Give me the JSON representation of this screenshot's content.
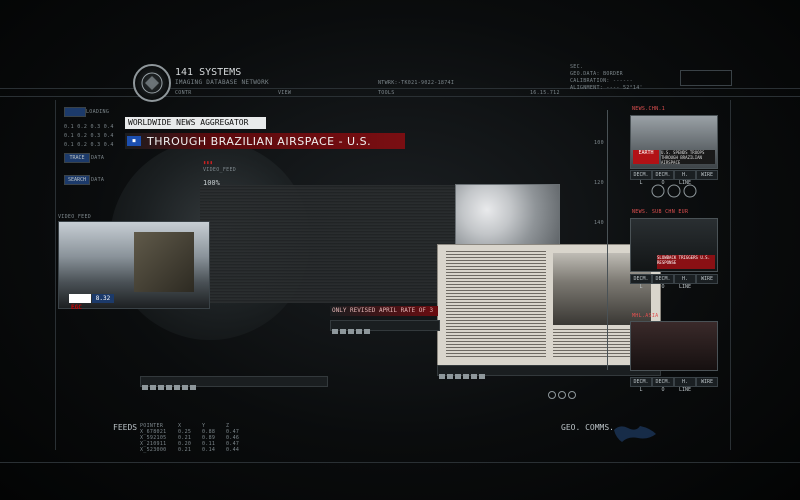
{
  "header": {
    "org": "141 SYSTEMS",
    "subtitle": "IMAGING DATABASE NETWORK",
    "menu": [
      "CONTR",
      "VIEW",
      "TOOLS"
    ],
    "network_id": "NTWRK:-TK021-9022-1874I",
    "version": "16.15.712",
    "right_info": [
      "SEC.",
      "GEO.DATA: BORDER",
      "CALIBRATION: ------",
      "ALIGNMENT: ---- 52°14'"
    ]
  },
  "left_controls": {
    "loading_label": "LOADING",
    "grid_rows": [
      "0.1  0.2  0.3  0.4",
      "0.1  0.2  0.3  0.4",
      "0.1  0.2  0.3  0.4"
    ],
    "trace_label": "DATA",
    "search_label": "DATA",
    "trace_btn": "TRACE",
    "search_btn": "SEARCH"
  },
  "aggregator": {
    "title": "WORLDWIDE NEWS AGGREGATOR",
    "headline": "THROUGH BRAZILIAN AIRSPACE -  U.S.",
    "feed_tag": "EGC",
    "ticker2": "ONLY REVISED APRIL RATE OF 3",
    "video_label": "VIDEO_FEED",
    "zoom": "100%",
    "small_feed_label": "VIDEO_FEED",
    "channel_badge": "8.32"
  },
  "right_panels": [
    {
      "title": "NEWS.CHN.1",
      "caption": "U.S. SPENDS TROOPS THROUGH BRAZILIAN AIRSPACE",
      "tag": "EARTH"
    },
    {
      "title": "NEWS. SUB CHN EUR",
      "caption": "SLOWBACK TRIGGERS U.S. RESPONSE",
      "tag": ""
    },
    {
      "title": "MHL.ASIA",
      "caption": "",
      "tag": ""
    }
  ],
  "panel_buttons": [
    "DECM. L",
    "DECM. O",
    "H. LINE",
    "WIRE"
  ],
  "bottom": {
    "feeds_label": "FEEDS",
    "table_headers": [
      "POINTER",
      "X",
      "Y",
      "Z"
    ],
    "table_rows": [
      [
        "X_678021",
        "0.25",
        "0.88",
        "0.47"
      ],
      [
        "X_592105",
        "0.21",
        "0.89",
        "0.46"
      ],
      [
        "X_210911",
        "0.20",
        "0.11",
        "0.47"
      ],
      [
        "X_523000",
        "0.21",
        "0.14",
        "0.44"
      ]
    ],
    "geo_label": "GEO. COMMS."
  },
  "ruler_marks": [
    "100",
    "120",
    "140"
  ]
}
